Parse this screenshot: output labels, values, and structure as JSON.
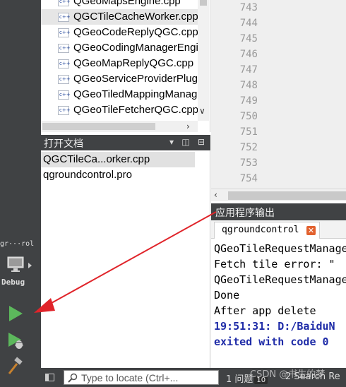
{
  "file_tree": {
    "items": [
      {
        "name": "QGeoMapsEngine.cpp",
        "selected": false
      },
      {
        "name": "QGCTileCacheWorker.cpp",
        "selected": true
      },
      {
        "name": "QGeoCodeReplyQGC.cpp",
        "selected": false
      },
      {
        "name": "QGeoCodingManagerEngineQGC.cpp",
        "selected": false
      },
      {
        "name": "QGeoMapReplyQGC.cpp",
        "selected": false
      },
      {
        "name": "QGeoServiceProviderPluginQGC.cpp",
        "selected": false
      },
      {
        "name": "QGeoTiledMappingManagerEngineQGC.cpp",
        "selected": false
      },
      {
        "name": "QGeoTileFetcherQGC.cpp",
        "selected": false
      }
    ]
  },
  "open_documents": {
    "title": "打开文档",
    "items": [
      "QGCTileCa...orker.cpp",
      "qgroundcontrol.pro"
    ],
    "selected_index": 0
  },
  "editor": {
    "line_numbers": [
      "743",
      "744",
      "745",
      "746",
      "747",
      "748",
      "749",
      "750",
      "751",
      "752",
      "753",
      "754"
    ]
  },
  "output": {
    "title": "应用程序输出",
    "tab_label": "qgroundcontrol",
    "lines": [
      {
        "text": "QGeoTileRequestManager",
        "style": "normal"
      },
      {
        "text": "Fetch tile error: \"",
        "style": "normal"
      },
      {
        "text": "QGeoTileRequestManager",
        "style": "normal"
      },
      {
        "text": "Done",
        "style": "normal"
      },
      {
        "text": "After app delete",
        "style": "normal"
      },
      {
        "text": "19:51:31: D:/BaiduN",
        "style": "blue"
      },
      {
        "text": "exited with code 0",
        "style": "blue"
      }
    ]
  },
  "sidebar": {
    "kit_name": "gr···rol",
    "kit_mode": "Debug",
    "icons": {
      "run": "run-icon",
      "debug_run": "debug-run-icon",
      "build": "build-hammer-icon",
      "kit": "monitor-icon"
    }
  },
  "status_bar": {
    "locator_placeholder": "Type to locate (Ctrl+...",
    "issues_label": "1 问题",
    "issues_count": "10",
    "search_label": "2 Search Re"
  },
  "watermark": "CSDN @书生的梦",
  "colors": {
    "dark_panel": "#404244",
    "output_blue": "#1f2ca8",
    "annotation_red": "#e0242a",
    "run_green": "#5cb85c"
  }
}
